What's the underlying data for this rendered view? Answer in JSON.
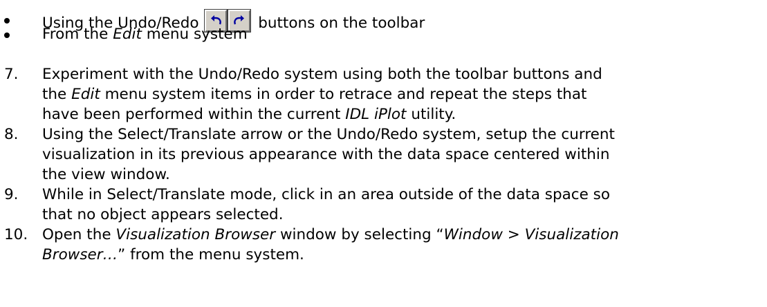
{
  "bullets": [
    {
      "pre": "Using the Undo/Redo ",
      "post": " buttons on the toolbar"
    },
    {
      "pre": "From the ",
      "em": "Edit",
      "post": " menu system"
    }
  ],
  "toolbar_icons": [
    "undo-icon",
    "redo-icon"
  ],
  "steps": [
    {
      "num": "7.",
      "l1_a": "Experiment with the Undo/Redo system using both the toolbar buttons and",
      "l2_a": "the ",
      "l2_em": "Edit",
      "l2_b": " menu system items in order to retrace and repeat the steps that",
      "l3_a": "have been performed within the current ",
      "l3_em": "IDL iPlot",
      "l3_b": " utility."
    },
    {
      "num": "8.",
      "l1": "Using the Select/Translate arrow or the Undo/Redo system, setup the current",
      "l2": "visualization in its previous appearance with the data space centered within",
      "l3": "the view window."
    },
    {
      "num": "9.",
      "l1": "While in Select/Translate mode, click in an area outside of the data space so",
      "l2": "that no object appears selected."
    },
    {
      "num": "10.",
      "l1_a": "Open the ",
      "l1_em": "Visualization Browser",
      "l1_b": " window by selecting “",
      "l1_em2": "Window > Visualization",
      "l2_em": "Browser…",
      "l2_b": "” from the menu system."
    }
  ]
}
